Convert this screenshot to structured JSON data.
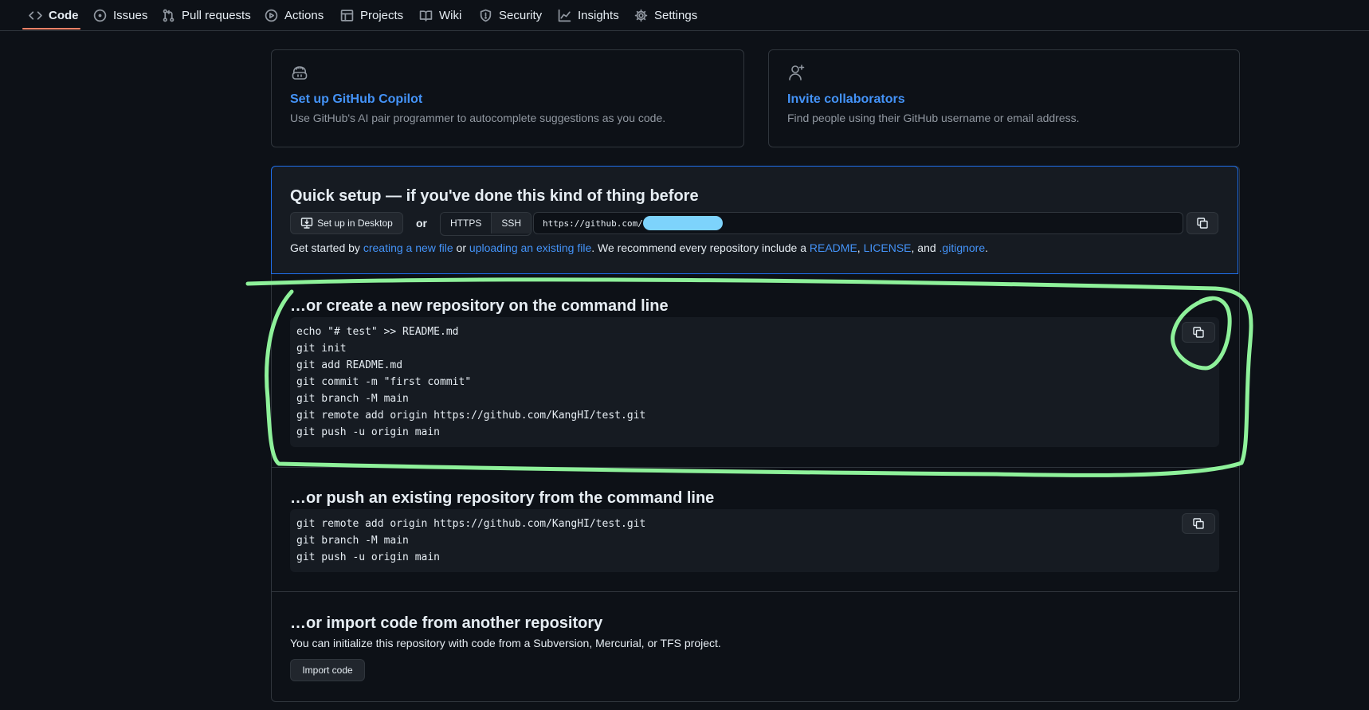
{
  "nav": {
    "items": [
      {
        "label": "Code",
        "icon": "code-icon"
      },
      {
        "label": "Issues",
        "icon": "issue-icon"
      },
      {
        "label": "Pull requests",
        "icon": "pull-request-icon"
      },
      {
        "label": "Actions",
        "icon": "play-icon"
      },
      {
        "label": "Projects",
        "icon": "table-icon"
      },
      {
        "label": "Wiki",
        "icon": "book-icon"
      },
      {
        "label": "Security",
        "icon": "shield-icon"
      },
      {
        "label": "Insights",
        "icon": "graph-icon"
      },
      {
        "label": "Settings",
        "icon": "gear-icon"
      }
    ],
    "active": "Code"
  },
  "cards": {
    "copilot": {
      "title": "Set up GitHub Copilot",
      "desc": "Use GitHub's AI pair programmer to autocomplete suggestions as you code."
    },
    "invite": {
      "title": "Invite collaborators",
      "desc": "Find people using their GitHub username or email address."
    }
  },
  "quick_setup": {
    "title": "Quick setup — if you've done this kind of thing before",
    "desktop_button": "Set up in Desktop",
    "or": "or",
    "https": "HTTPS",
    "ssh": "SSH",
    "url_prefix": "https://github.com/",
    "get_started_prefix": "Get started by ",
    "link_new_file": "creating a new file",
    "or_text": " or ",
    "link_upload": "uploading an existing file",
    "recommend": ". We recommend every repository include a ",
    "link_readme": "README",
    "comma1": ", ",
    "link_license": "LICENSE",
    "and": ", and ",
    "link_gitignore": ".gitignore",
    "period": "."
  },
  "create_section": {
    "title": "…or create a new repository on the command line",
    "lines": [
      "echo \"# test\" >> README.md",
      "git init",
      "git add README.md",
      "git commit -m \"first commit\"",
      "git branch -M main",
      "git remote add origin https://github.com/KangHI/test.git",
      "git push -u origin main"
    ]
  },
  "push_section": {
    "title": "…or push an existing repository from the command line",
    "lines": [
      "git remote add origin https://github.com/KangHI/test.git",
      "git branch -M main",
      "git push -u origin main"
    ]
  },
  "import_section": {
    "title": "…or import code from another repository",
    "desc": "You can initialize this repository with code from a Subversion, Mercurial, or TFS project.",
    "button": "Import code"
  },
  "colors": {
    "background": "#0d1117",
    "link": "#4493f8",
    "accent_underline": "#f78166",
    "annotation": "#8ef19a",
    "redaction": "#7dd3fc"
  }
}
